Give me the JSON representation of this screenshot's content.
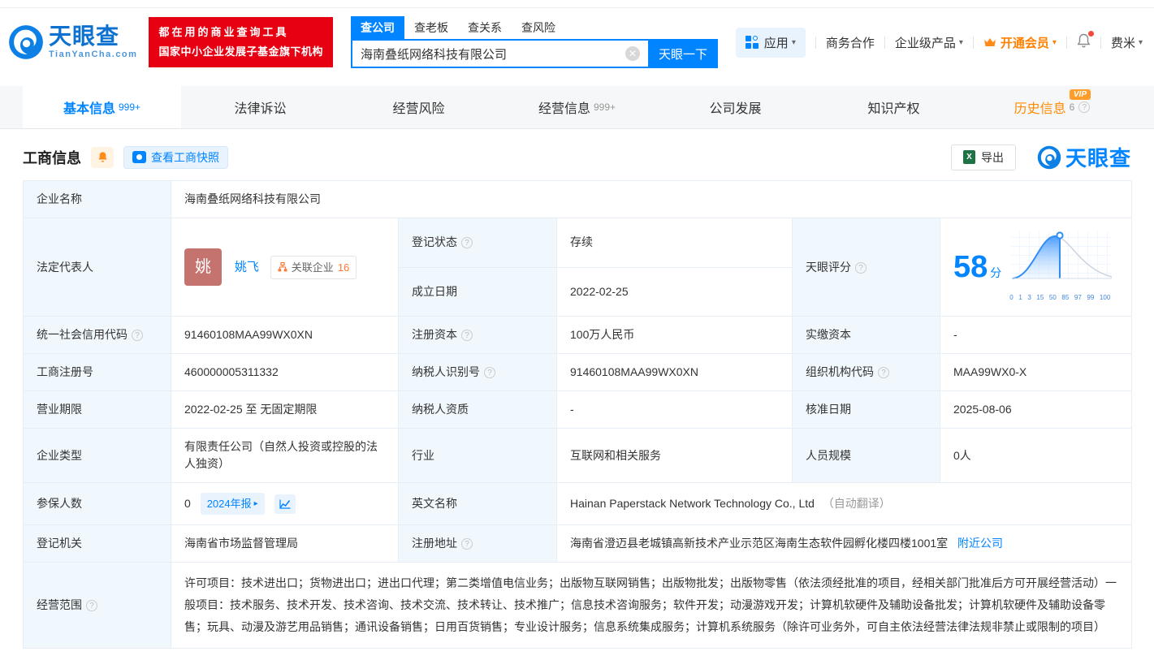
{
  "header": {
    "logo_title": "天眼查",
    "logo_domain": "TianYanCha.com",
    "slogan_line1": "都在用的商业查询工具",
    "slogan_line2": "国家中小企业发展子基金旗下机构",
    "search_tabs": [
      {
        "label": "查公司"
      },
      {
        "label": "查老板"
      },
      {
        "label": "查关系"
      },
      {
        "label": "查风险"
      }
    ],
    "search_value": "海南叠纸网络科技有限公司",
    "search_button": "天眼一下",
    "nav": {
      "apps": "应用",
      "cooperation": "商务合作",
      "enterprise": "企业级产品",
      "vip": "开通会员",
      "user": "费米"
    }
  },
  "tabs": [
    {
      "label": "基本信息",
      "badge": "999+"
    },
    {
      "label": "法律诉讼",
      "badge": ""
    },
    {
      "label": "经营风险",
      "badge": ""
    },
    {
      "label": "经营信息",
      "badge": "999+"
    },
    {
      "label": "公司发展",
      "badge": ""
    },
    {
      "label": "知识产权",
      "badge": ""
    },
    {
      "label": "历史信息",
      "badge": "6",
      "vip_tag": "VIP"
    }
  ],
  "section": {
    "title": "工商信息",
    "snapshot_button": "查看工商快照",
    "export_button": "导出",
    "watermark_logo": "天眼查"
  },
  "company": {
    "name_label": "企业名称",
    "name": "海南叠纸网络科技有限公司",
    "legal_rep_label": "法定代表人",
    "legal_rep_avatar": "姚",
    "legal_rep_name": "姚飞",
    "related_label": "关联企业",
    "related_count": "16"
  },
  "score": {
    "label": "天眼评分",
    "value": "58",
    "unit": "分",
    "ticks": [
      "0",
      "1",
      "3",
      "15",
      "50",
      "85",
      "97",
      "99",
      "100"
    ]
  },
  "chart_data": {
    "type": "area",
    "title": "天眼评分 distribution curve",
    "score": 58,
    "x_ticks": [
      0,
      1,
      3,
      15,
      50,
      85,
      97,
      99,
      100
    ],
    "marker_at_percentile": 58,
    "filled_region": "left of marker",
    "accent_color": "#2f8ef5"
  },
  "fields": {
    "reg_status": {
      "label": "登记状态",
      "value": "存续"
    },
    "establish_date": {
      "label": "成立日期",
      "value": "2022-02-25"
    },
    "credit_code": {
      "label": "统一社会信用代码",
      "value": "91460108MAA99WX0XN"
    },
    "reg_capital": {
      "label": "注册资本",
      "value": "100万人民币"
    },
    "paid_capital": {
      "label": "实缴资本",
      "value": "-"
    },
    "reg_number": {
      "label": "工商注册号",
      "value": "460000005311332"
    },
    "taxpayer_id": {
      "label": "纳税人识别号",
      "value": "91460108MAA99WX0XN"
    },
    "org_code": {
      "label": "组织机构代码",
      "value": "MAA99WX0-X"
    },
    "business_term": {
      "label": "营业期限",
      "value": "2022-02-25 至 无固定期限"
    },
    "taxpayer_quality": {
      "label": "纳税人资质",
      "value": "-"
    },
    "approval_date": {
      "label": "核准日期",
      "value": "2025-08-06"
    },
    "company_type": {
      "label": "企业类型",
      "value": "有限责任公司（自然人投资或控股的法人独资）"
    },
    "industry": {
      "label": "行业",
      "value": "互联网和相关服务"
    },
    "staff_size": {
      "label": "人员规模",
      "value": "0人"
    },
    "insured": {
      "label": "参保人数",
      "value": "0",
      "report_badge": "2024年报"
    },
    "english_name": {
      "label": "英文名称",
      "value": "Hainan Paperstack Network Technology Co., Ltd",
      "note": "（自动翻译）"
    },
    "reg_authority": {
      "label": "登记机关",
      "value": "海南省市场监督管理局"
    },
    "reg_address": {
      "label": "注册地址",
      "value": "海南省澄迈县老城镇高新技术产业示范区海南生态软件园孵化楼四楼1001室",
      "link": "附近公司"
    },
    "business_scope": {
      "label": "经营范围",
      "value": "许可项目：技术进出口；货物进出口；进出口代理；第二类增值电信业务；出版物互联网销售；出版物批发；出版物零售（依法须经批准的项目，经相关部门批准后方可开展经营活动）一般项目：技术服务、技术开发、技术咨询、技术交流、技术转让、技术推广；信息技术咨询服务；软件开发；动漫游戏开发；计算机软硬件及辅助设备批发；计算机软硬件及辅助设备零售；玩具、动漫及游艺用品销售；通讯设备销售；日用百货销售；专业设计服务；信息系统集成服务；计算机系统服务（除许可业务外，可自主依法经营法律法规非禁止或限制的项目）"
    }
  }
}
